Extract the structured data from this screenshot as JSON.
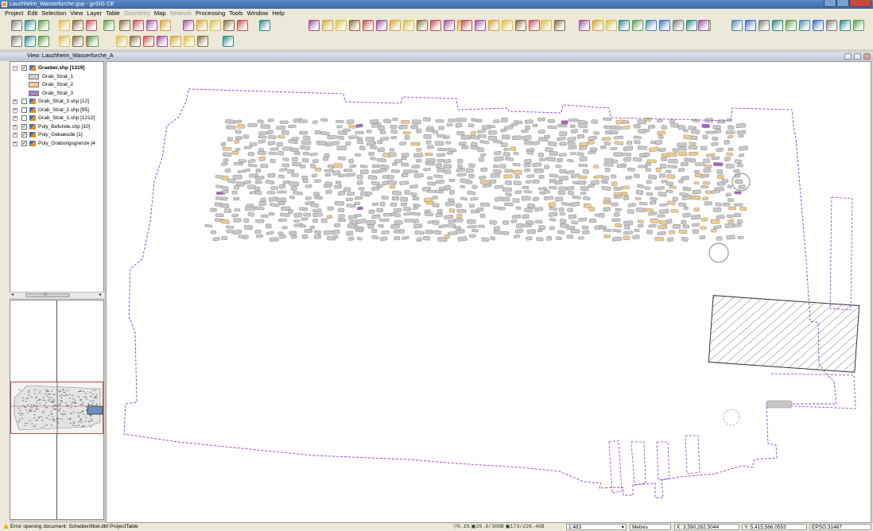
{
  "window": {
    "title": "Lauchheim_Wasserfurche.gvp - gvSIG CE"
  },
  "menu": {
    "items": [
      "Project",
      "Edit",
      "Selection",
      "View",
      "Layer",
      "Table",
      "Geometry",
      "Map",
      "Network",
      "Processing",
      "Tools",
      "Window",
      "Help"
    ],
    "disabled": [
      "Geometry",
      "Network"
    ]
  },
  "view": {
    "title": "View: Lauchheim_Wasserfurche_A"
  },
  "toc": {
    "layers": [
      {
        "name": "Graeber.shp [1319]",
        "checked": true,
        "expanded": true,
        "bold": true
      },
      {
        "name": "Grab_Strat_3.shp [12]",
        "checked": false,
        "expanded": false,
        "bold": false
      },
      {
        "name": "Grab_Strat_2.shp [95]",
        "checked": false,
        "expanded": false,
        "bold": false
      },
      {
        "name": "Grab_Strat_1.shp [1212]",
        "checked": false,
        "expanded": false,
        "bold": false
      },
      {
        "name": "Poly_Befunde.shp [10]",
        "checked": true,
        "expanded": false,
        "bold": false
      },
      {
        "name": "Poly_Gebaeude [1]",
        "checked": true,
        "expanded": false,
        "bold": false
      },
      {
        "name": "Poly_Grabungsgrenze [4",
        "checked": true,
        "expanded": false,
        "bold": false
      }
    ],
    "legend": [
      {
        "label": "Grab_Strat_1",
        "color": "#cfcfcf"
      },
      {
        "label": "Grab_Strat_2",
        "color": "#f3cf95"
      },
      {
        "label": "Grab_Strat_3",
        "color": "#b07cc6"
      }
    ],
    "scroll_thumb_label": "III"
  },
  "map": {
    "boundary_color": "#8a3ad0",
    "feature_fill": "#c8c8c8",
    "feature_stroke": "#8c8c8c",
    "hatch_color": "#444444"
  },
  "status": {
    "message": "Error opening document: Scheibenfibel.dbf ProjectTable",
    "percent": "0.1%",
    "disk1": "29.9/30GB",
    "disk2": "173/226.4GB",
    "scale": "1:483",
    "units": "Metres",
    "x": "X: 3,590,282.5044",
    "y": "Y: 5,415,566.0553",
    "crs": "EPSG:31467"
  }
}
